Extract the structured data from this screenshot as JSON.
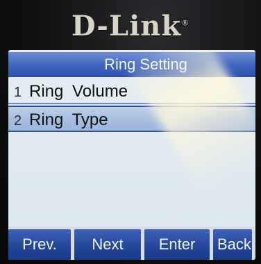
{
  "device": {
    "brand": "D-Link",
    "brand_mark": "®"
  },
  "screen": {
    "title": "Ring Setting",
    "menu_items": [
      {
        "number": "1",
        "label": "Ring Volume",
        "selected": false
      },
      {
        "number": "2",
        "label": "Ring Type",
        "selected": true
      }
    ],
    "softkeys": {
      "prev": "Prev.",
      "next": "Next",
      "enter": "Enter",
      "back": "Back"
    }
  }
}
